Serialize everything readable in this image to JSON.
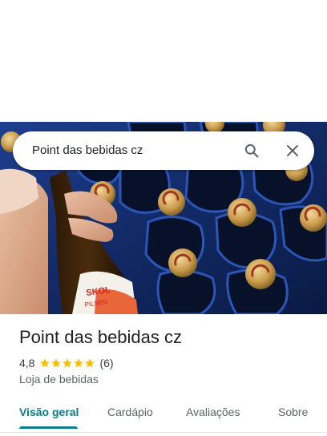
{
  "search": {
    "query": "Point das bebidas cz"
  },
  "photo": {
    "bottle_label_brand": "SKOL",
    "bottle_label_sub": "PILSEN"
  },
  "place": {
    "name": "Point das bebidas cz",
    "rating": "4,8",
    "stars": 5,
    "review_count": "(6)",
    "category": "Loja de bebidas"
  },
  "tabs": [
    {
      "label": "Visão geral",
      "active": true
    },
    {
      "label": "Cardápio",
      "active": false
    },
    {
      "label": "Avaliações",
      "active": false
    },
    {
      "label": "Sobre",
      "active": false
    }
  ],
  "colors": {
    "accent": "#0b7a8a",
    "star": "#fbbc04",
    "crate": "#1a3d8f",
    "cap": "#c9a050"
  }
}
